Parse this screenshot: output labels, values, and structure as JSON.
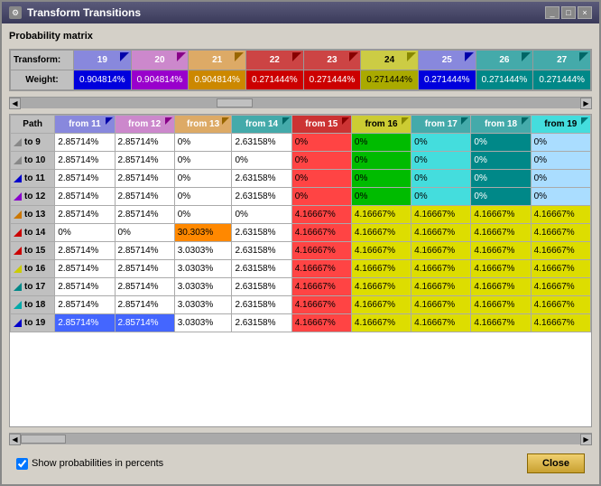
{
  "window": {
    "title": "Transform Transitions",
    "icon": "⚙"
  },
  "section": {
    "label": "Probability matrix"
  },
  "top_headers": {
    "transform_label": "Transform:",
    "weight_label": "Weight:",
    "columns": [
      {
        "id": "19",
        "label": "19",
        "tri_color": "blue"
      },
      {
        "id": "20",
        "label": "20",
        "tri_color": "purple"
      },
      {
        "id": "21",
        "label": "21",
        "tri_color": "orange"
      },
      {
        "id": "22",
        "label": "22",
        "tri_color": "red"
      },
      {
        "id": "23",
        "label": "23",
        "tri_color": "red"
      },
      {
        "id": "24",
        "label": "24",
        "tri_color": "yellow"
      },
      {
        "id": "25",
        "label": "25",
        "tri_color": "blue"
      },
      {
        "id": "26",
        "label": "26",
        "tri_color": "teal"
      },
      {
        "id": "27",
        "label": "27",
        "tri_color": "teal"
      }
    ],
    "weights": [
      {
        "val": "0.904814%",
        "color": "blue"
      },
      {
        "val": "0.904814%",
        "color": "purple"
      },
      {
        "val": "0.904814%",
        "color": "orange"
      },
      {
        "val": "0.271444%",
        "color": "red"
      },
      {
        "val": "0.271444%",
        "color": "red"
      },
      {
        "val": "0.271444%",
        "color": "yellow"
      },
      {
        "val": "0.271444%",
        "color": "blue"
      },
      {
        "val": "0.271444%",
        "color": "teal"
      },
      {
        "val": "0.271444%",
        "color": "teal"
      }
    ]
  },
  "grid": {
    "col_headers": [
      "from 11",
      "from 12",
      "from 13",
      "from 14",
      "from 15",
      "from 16",
      "from 17",
      "from 18",
      "from 19"
    ],
    "col_colors": [
      "blue",
      "purple",
      "orange",
      "teal",
      "red",
      "yellow",
      "teal",
      "teal",
      "cyan"
    ],
    "rows": [
      {
        "label": "to 9",
        "tri": "gray",
        "cells": [
          "2.85714%",
          "2.85714%",
          "0%",
          "2.63158%",
          "0%",
          "0%",
          "0%",
          "0%",
          "0%"
        ]
      },
      {
        "label": "to 10",
        "tri": "gray",
        "cells": [
          "2.85714%",
          "2.85714%",
          "0%",
          "0%",
          "0%",
          "0%",
          "0%",
          "0%",
          "0%"
        ]
      },
      {
        "label": "to 11",
        "tri": "blue",
        "cells": [
          "2.85714%",
          "2.85714%",
          "0%",
          "2.63158%",
          "0%",
          "0%",
          "0%",
          "0%",
          "0%"
        ]
      },
      {
        "label": "to 12",
        "tri": "purple",
        "cells": [
          "2.85714%",
          "2.85714%",
          "0%",
          "2.63158%",
          "0%",
          "0%",
          "0%",
          "0%",
          "0%"
        ]
      },
      {
        "label": "to 13",
        "tri": "orange",
        "cells": [
          "2.85714%",
          "2.85714%",
          "0%",
          "0%",
          "4.16667%",
          "4.16667%",
          "4.16667%",
          "4.16667%",
          "4.16667%"
        ]
      },
      {
        "label": "to 14",
        "tri": "red",
        "cells": [
          "0%",
          "0%",
          "30.303%",
          "2.63158%",
          "4.16667%",
          "4.16667%",
          "4.16667%",
          "4.16667%",
          "4.16667%"
        ]
      },
      {
        "label": "to 15",
        "tri": "red",
        "cells": [
          "2.85714%",
          "2.85714%",
          "3.0303%",
          "2.63158%",
          "4.16667%",
          "4.16667%",
          "4.16667%",
          "4.16667%",
          "4.16667%"
        ]
      },
      {
        "label": "to 16",
        "tri": "yellow",
        "cells": [
          "2.85714%",
          "2.85714%",
          "3.0303%",
          "2.63158%",
          "4.16667%",
          "4.16667%",
          "4.16667%",
          "4.16667%",
          "4.16667%"
        ]
      },
      {
        "label": "to 17",
        "tri": "teal",
        "cells": [
          "2.85714%",
          "2.85714%",
          "3.0303%",
          "2.63158%",
          "4.16667%",
          "4.16667%",
          "4.16667%",
          "4.16667%",
          "4.16667%"
        ]
      },
      {
        "label": "to 18",
        "tri": "cyan",
        "cells": [
          "2.85714%",
          "2.85714%",
          "3.0303%",
          "2.63158%",
          "4.16667%",
          "4.16667%",
          "4.16667%",
          "4.16667%",
          "4.16667%"
        ]
      },
      {
        "label": "to 19",
        "tri": "blue",
        "cells": [
          "2.85714%",
          "2.85714%",
          "3.0303%",
          "2.63158%",
          "4.16667%",
          "4.16667%",
          "4.16667%",
          "4.16667%",
          "4.16667%"
        ]
      }
    ],
    "cell_colors": [
      [
        "white",
        "white",
        "white",
        "white",
        "red",
        "green",
        "cyan",
        "teal",
        "lightblue"
      ],
      [
        "white",
        "white",
        "white",
        "white",
        "red",
        "green",
        "cyan",
        "teal",
        "lightblue"
      ],
      [
        "white",
        "white",
        "white",
        "white",
        "red",
        "green",
        "cyan",
        "teal",
        "lightblue"
      ],
      [
        "white",
        "white",
        "white",
        "white",
        "red",
        "green",
        "cyan",
        "teal",
        "lightblue"
      ],
      [
        "white",
        "white",
        "white",
        "white",
        "red",
        "yellow",
        "yellow",
        "yellow",
        "yellow"
      ],
      [
        "white",
        "white",
        "orange",
        "white",
        "red",
        "yellow",
        "yellow",
        "yellow",
        "yellow"
      ],
      [
        "white",
        "white",
        "white",
        "white",
        "red",
        "yellow",
        "yellow",
        "yellow",
        "yellow"
      ],
      [
        "white",
        "white",
        "white",
        "white",
        "red",
        "yellow",
        "yellow",
        "yellow",
        "yellow"
      ],
      [
        "white",
        "white",
        "white",
        "white",
        "red",
        "yellow",
        "yellow",
        "yellow",
        "yellow"
      ],
      [
        "white",
        "white",
        "white",
        "white",
        "red",
        "yellow",
        "yellow",
        "yellow",
        "yellow"
      ],
      [
        "blue",
        "blue",
        "white",
        "white",
        "red",
        "yellow",
        "yellow",
        "yellow",
        "yellow"
      ]
    ]
  },
  "bottom": {
    "checkbox_label": "Show probabilities in percents",
    "checkbox_checked": true,
    "close_button": "Close"
  }
}
